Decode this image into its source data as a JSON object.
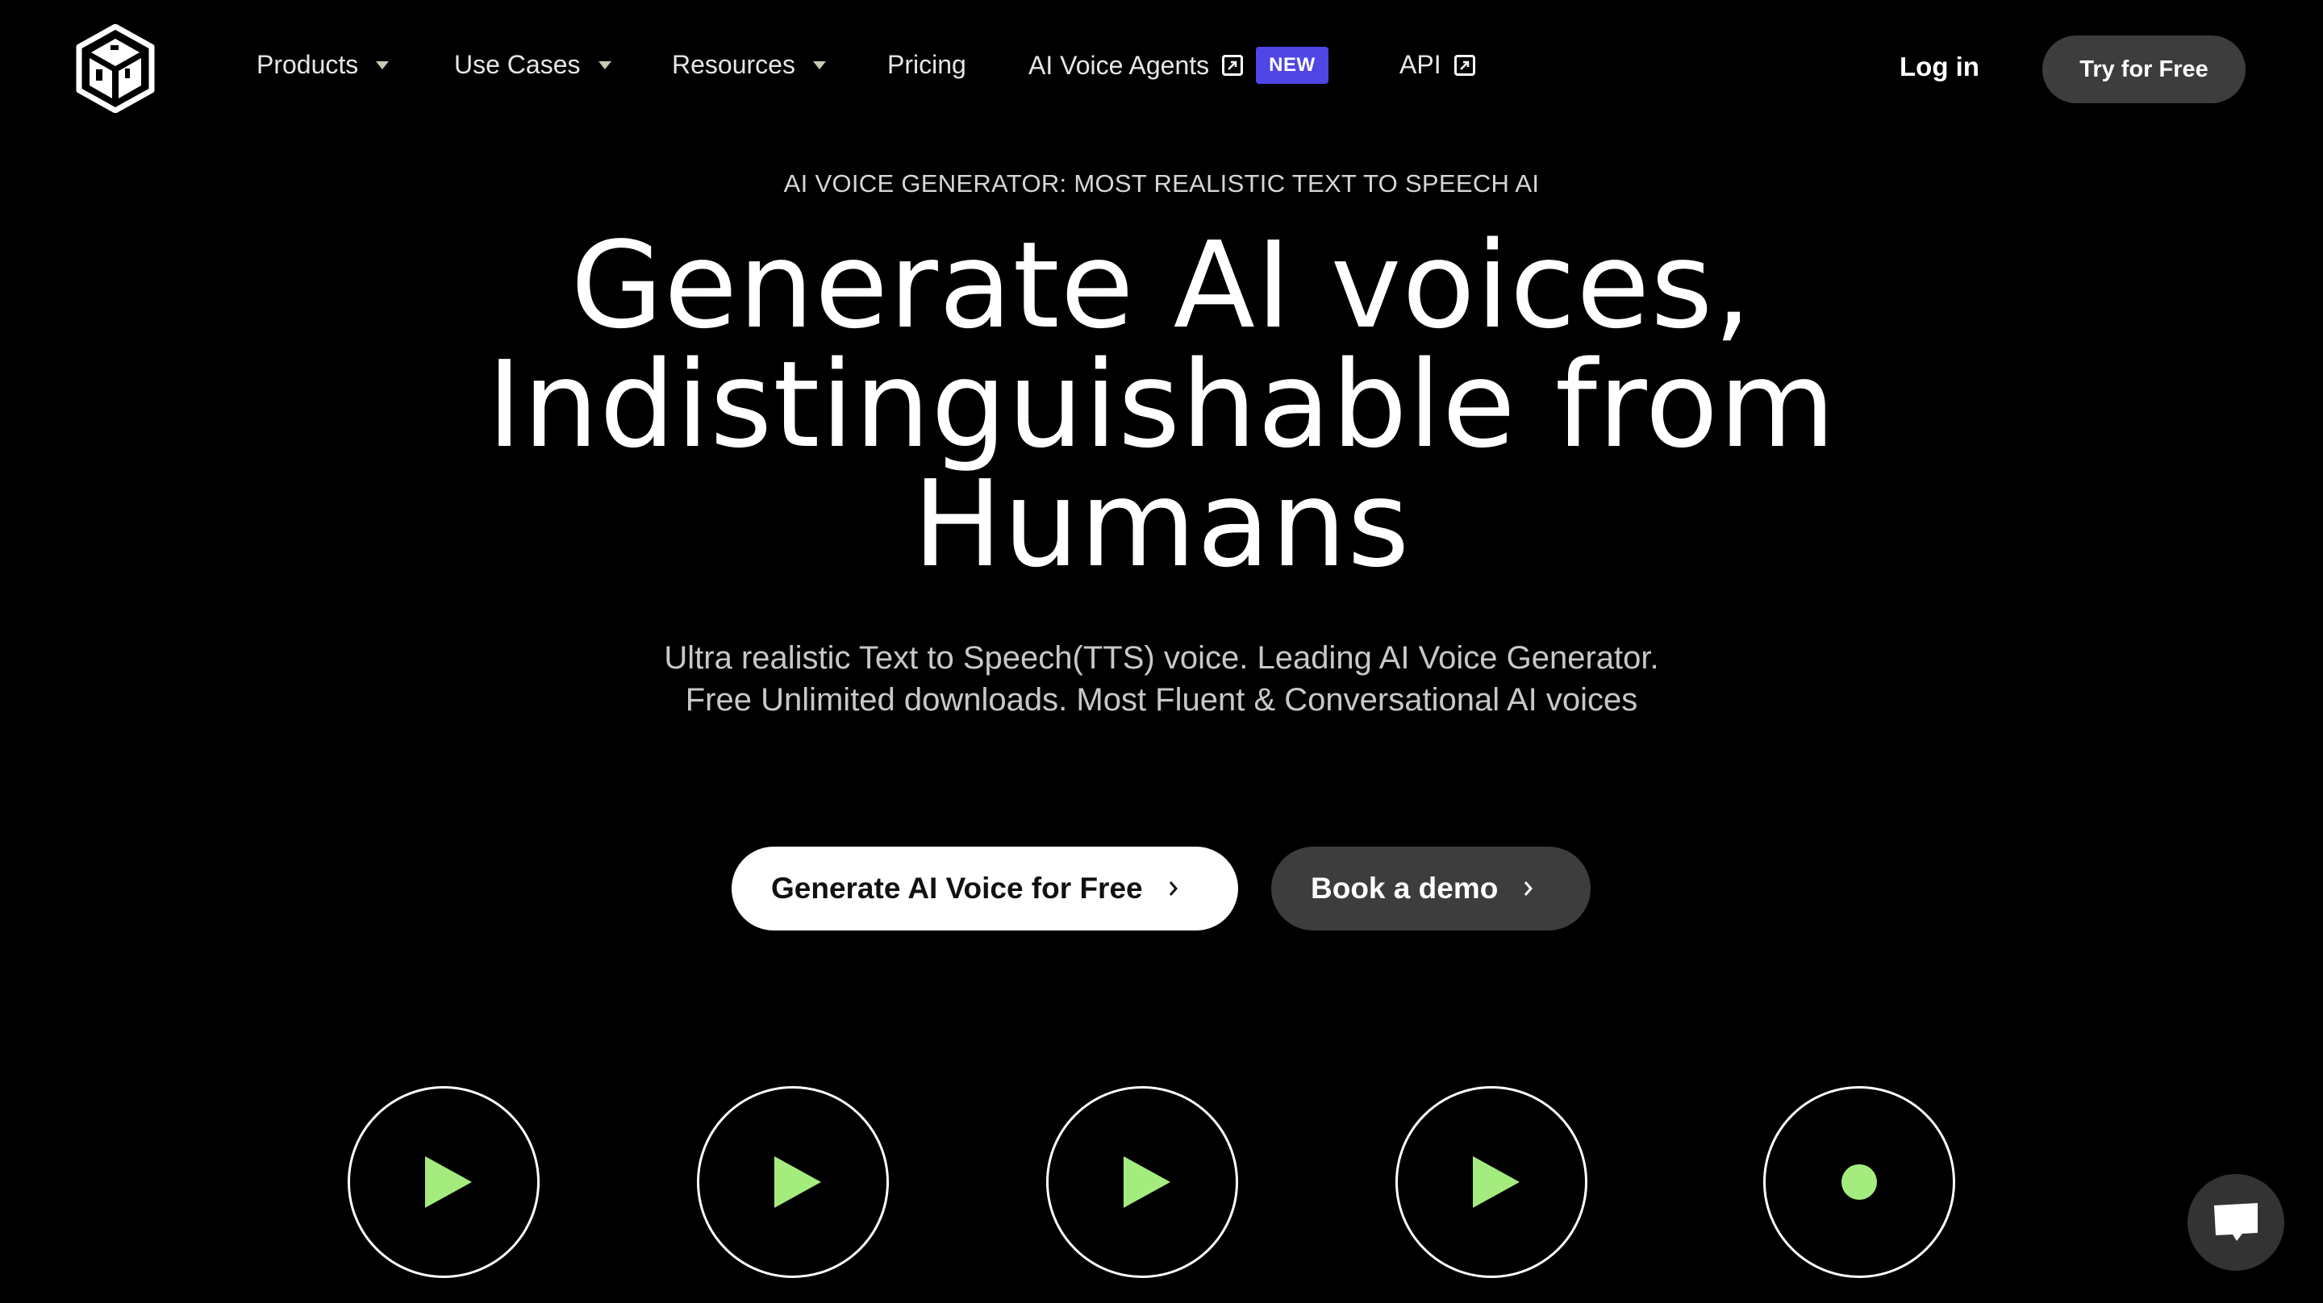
{
  "brand": {
    "logo_icon": "playht-cube-logo"
  },
  "nav": {
    "items": [
      {
        "label": "Products",
        "has_dropdown": true
      },
      {
        "label": "Use Cases",
        "has_dropdown": true
      },
      {
        "label": "Resources",
        "has_dropdown": true
      },
      {
        "label": "Pricing",
        "has_dropdown": false
      },
      {
        "label": "AI Voice Agents",
        "external": true,
        "badge": "NEW"
      },
      {
        "label": "API",
        "external": true
      }
    ],
    "login_label": "Log in",
    "cta_label": "Try for Free"
  },
  "hero": {
    "tagline": "AI VOICE GENERATOR: MOST REALISTIC TEXT TO SPEECH AI",
    "headline_lines": [
      "Generate AI voices,",
      "Indistinguishable from",
      "Humans"
    ],
    "subtitle_lines": [
      "Ultra realistic Text to Speech(TTS) voice. Leading AI Voice Generator.",
      "Free Unlimited downloads. Most Fluent & Conversational AI voices"
    ],
    "primary_button": "Generate AI Voice for Free",
    "secondary_button": "Book a demo"
  },
  "players": [
    {
      "icon": "play-icon"
    },
    {
      "icon": "play-icon"
    },
    {
      "icon": "play-icon"
    },
    {
      "icon": "play-icon"
    },
    {
      "icon": "record-dot-icon"
    }
  ],
  "colors": {
    "accent_green": "#a5ec7e",
    "badge_purple": "#4f46e5",
    "dark_button": "#3d3d3d",
    "background": "#000000"
  },
  "chat": {
    "icon": "chat-bubble-icon"
  }
}
